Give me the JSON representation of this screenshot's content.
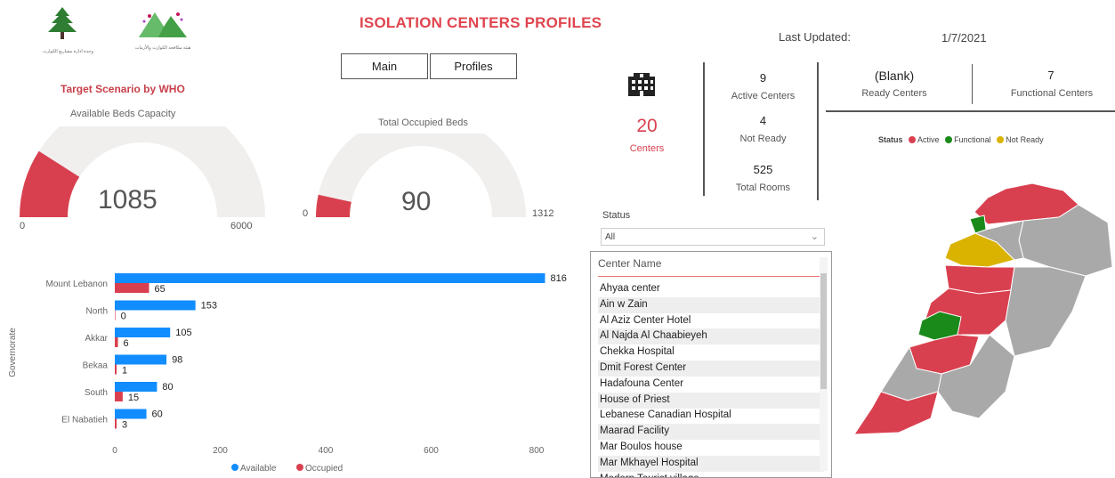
{
  "header": {
    "title": "ISOLATION CENTERS PROFILES",
    "last_updated_label": "Last Updated:",
    "last_updated_date": "1/7/2021",
    "logo1_caption": "وحدة ادارة مشاريع الكوارث",
    "logo2_caption": "هيئة مكافحة الكوارث والأزمات"
  },
  "nav": {
    "main_label": "Main",
    "profiles_label": "Profiles"
  },
  "gauges": {
    "section_title": "Target Scenario by WHO",
    "available": {
      "label": "Available Beds Capacity",
      "value": "1085",
      "min": "0",
      "max": "6000",
      "fraction": 0.1808
    },
    "occupied": {
      "label": "Total Occupied Beds",
      "value": "90",
      "min": "0",
      "max": "1312",
      "fraction": 0.0686
    }
  },
  "kpis": {
    "centers_count": "20",
    "centers_label": "Centers",
    "active_count": "9",
    "active_label": "Active Centers",
    "not_ready_count": "4",
    "not_ready_label": "Not Ready",
    "rooms_count": "525",
    "rooms_label": "Total Rooms",
    "ready_value": "(Blank)",
    "ready_label": "Ready Centers",
    "functional_count": "7",
    "functional_label": "Functional Centers"
  },
  "map_legend": {
    "title": "Status",
    "items": [
      {
        "label": "Active",
        "color": "#d9404f"
      },
      {
        "label": "Functional",
        "color": "#1a8a1a"
      },
      {
        "label": "Not Ready",
        "color": "#d9b300"
      }
    ]
  },
  "status_slicer": {
    "title": "Status",
    "selected": "All"
  },
  "center_slicer": {
    "header": "Center Name",
    "items": [
      "Ahyaa center",
      "Ain w Zain",
      "Al Aziz Center Hotel",
      "Al Najda Al Chaabieyeh",
      "Chekka Hospital",
      "Dmit Forest Center",
      "Hadafouna Center",
      "House of Priest",
      "Lebanese Canadian Hospital",
      "Maarad Facility",
      "Mar Boulos house",
      "Mar Mkhayel Hospital",
      "Modern Tourist village"
    ]
  },
  "chart_data": {
    "type": "bar",
    "orientation": "horizontal",
    "ylabel": "Governorate",
    "categories": [
      "Mount Lebanon",
      "North",
      "Akkar",
      "Bekaa",
      "South",
      "El Nabatieh"
    ],
    "series": [
      {
        "name": "Available",
        "values": [
          816,
          153,
          105,
          98,
          80,
          60
        ],
        "color": "#118dff"
      },
      {
        "name": "Occupied",
        "values": [
          65,
          0,
          6,
          1,
          15,
          3
        ],
        "color": "#d9404f"
      }
    ],
    "xlim": [
      0,
      800
    ],
    "xticks": [
      "0",
      "200",
      "400",
      "600",
      "800"
    ],
    "grid": false,
    "legend": "bottom-center"
  }
}
